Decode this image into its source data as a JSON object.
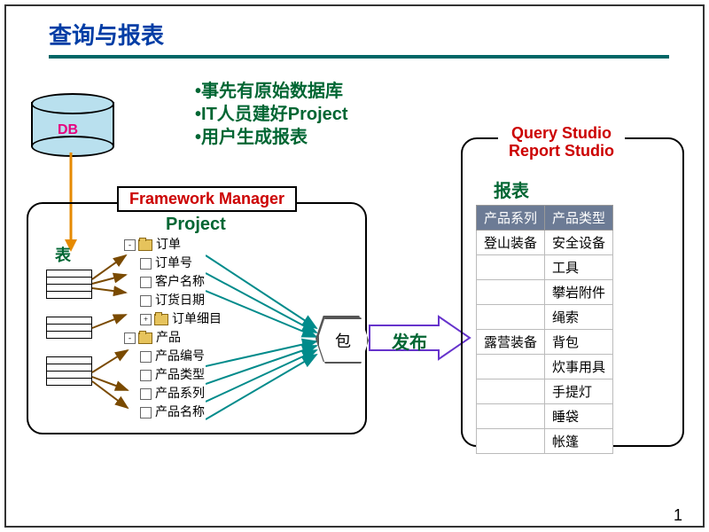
{
  "title": "查询与报表",
  "bullets": [
    "事先有原始数据库",
    "IT人员建好Project",
    "用户生成报表"
  ],
  "db_label": "DB",
  "framework_manager": {
    "title": "Framework Manager",
    "project_label": "Project",
    "table_label": "表"
  },
  "tree": {
    "nodes": [
      {
        "type": "folder",
        "expand": "-",
        "label": "订单"
      },
      {
        "type": "item",
        "label": "订单号"
      },
      {
        "type": "item",
        "label": "客户名称"
      },
      {
        "type": "item",
        "label": "订货日期"
      },
      {
        "type": "folder",
        "expand": "+",
        "label": "订单细目"
      },
      {
        "type": "folder",
        "expand": "-",
        "label": "产品"
      },
      {
        "type": "item",
        "label": "产品编号"
      },
      {
        "type": "item",
        "label": "产品类型"
      },
      {
        "type": "item",
        "label": "产品系列"
      },
      {
        "type": "item",
        "label": "产品名称"
      }
    ]
  },
  "package_label": "包",
  "publish_label": "发布",
  "report_studio": {
    "title_line1": "Query Studio",
    "title_line2": "Report Studio",
    "report_label": "报表",
    "columns": [
      "产品系列",
      "产品类型"
    ],
    "rows": [
      [
        "登山装备",
        "安全设备"
      ],
      [
        "",
        "工具"
      ],
      [
        "",
        "攀岩附件"
      ],
      [
        "",
        "绳索"
      ],
      [
        "露营装备",
        "背包"
      ],
      [
        "",
        "炊事用具"
      ],
      [
        "",
        "手提灯"
      ],
      [
        "",
        "睡袋"
      ],
      [
        "",
        "帐篷"
      ]
    ]
  },
  "page_number": "1"
}
